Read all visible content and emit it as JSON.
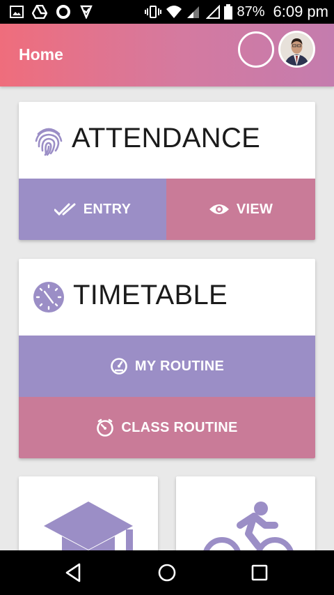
{
  "status_bar": {
    "battery": "87%",
    "time": "6:09 pm"
  },
  "app_bar": {
    "title": "Home"
  },
  "attendance": {
    "title": "ATTENDANCE",
    "entry_label": "ENTRY",
    "view_label": "VIEW"
  },
  "timetable": {
    "title": "TIMETABLE",
    "my_routine_label": "MY ROUTINE",
    "class_routine_label": "CLASS ROUTINE"
  },
  "colors": {
    "accent_purple": "#9b8ec6",
    "accent_pink": "#c97b98",
    "header_start": "#ef6d7c",
    "header_end": "#c47cae"
  }
}
